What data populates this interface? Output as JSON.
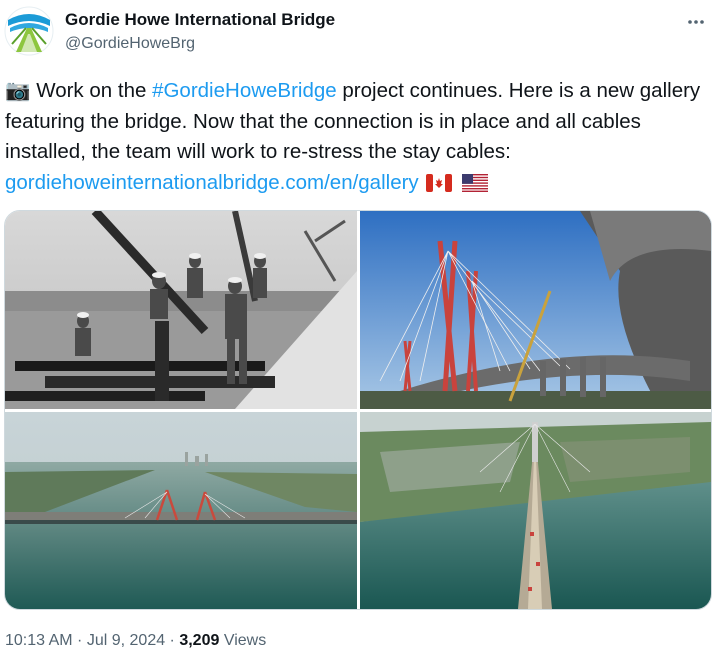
{
  "author": {
    "name": "Gordie Howe International Bridge",
    "handle": "@GordieHoweBrg"
  },
  "tweet": {
    "camera_emoji": "📷",
    "text_1": " Work on the ",
    "hashtag": "#GordieHoweBridge",
    "text_2": " project continues. Here is a new gallery featuring the bridge. Now that the connection is in place and all cables installed, the team will work to re-stress the stay cables: ",
    "url": "gordiehoweinternationalbridge.com/en/gallery",
    "flag_1": "canada-flag-icon",
    "flag_2": "us-flag-icon"
  },
  "media": [
    {
      "alt": "black-and-white photo of construction workers on the bridge deck"
    },
    {
      "alt": "low angle view of the bridge towers with cranes"
    },
    {
      "alt": "aerial view of the bridge spanning the river with cranes"
    },
    {
      "alt": "aerial view looking down the bridge deck across the river"
    }
  ],
  "meta": {
    "time": "10:13 AM",
    "sep_1": " · ",
    "date": "Jul 9, 2024",
    "sep_2": " · ",
    "views_count": "3,209",
    "views_label": " Views"
  },
  "colors": {
    "link": "#1d9bf0",
    "secondary_text": "#536471",
    "primary_text": "#0f1419"
  },
  "icons": {
    "avatar": "bridge-logo-icon",
    "more": "more-options-icon"
  }
}
